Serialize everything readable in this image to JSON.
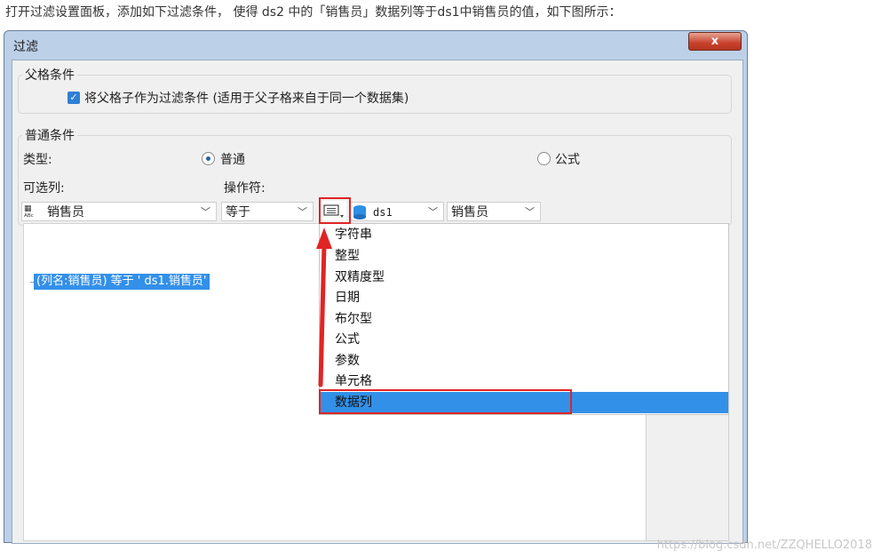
{
  "caption": "打开过滤设置面板，添加如下过滤条件， 使得 ds2 中的「销售员」数据列等于ds1中销售员的值，如下图所示：",
  "dialog": {
    "title": "过滤",
    "close_label": "x"
  },
  "parent_group": {
    "title": "父格条件",
    "checkbox_label": "将父格子作为过滤条件 (适用于父子格来自于同一个数据集)",
    "checked": true
  },
  "normal_group": {
    "title": "普通条件",
    "type_label": "类型:",
    "radio_normal": "普通",
    "radio_formula": "公式",
    "selected_type": "普通",
    "columns_label": "可选列:",
    "operator_label": "操作符:",
    "column_value": "销售员",
    "operator_value": "等于",
    "dataset_value": "ds1",
    "field_value": "销售员"
  },
  "condition_text": "(列名:销售员) 等于 ' ds1.销售员'",
  "type_menu": {
    "items": [
      "字符串",
      "整型",
      "双精度型",
      "日期",
      "布尔型",
      "公式",
      "参数",
      "单元格",
      "数据列"
    ],
    "selected": "数据列"
  },
  "icons": {
    "column": "abc-column-icon",
    "type_selector": "list-type-icon",
    "dataset": "database-icon",
    "dropdown": "chevron-down-icon"
  },
  "colors": {
    "highlight": "#3390e8",
    "annotation": "#e02424"
  },
  "watermark": "https://blog.csdn.net/ZZQHELLO2018"
}
